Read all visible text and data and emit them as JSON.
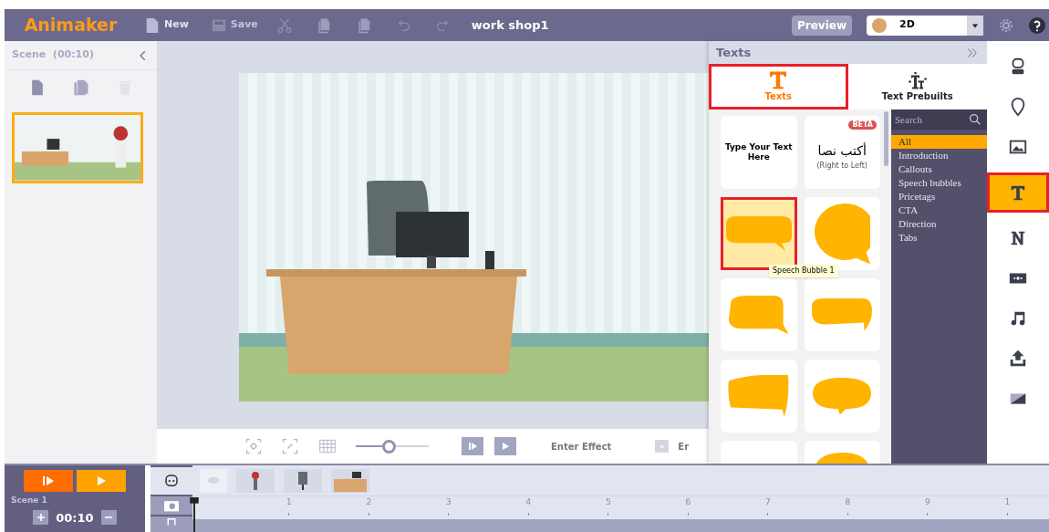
{
  "toolbar": {
    "logo": "Animaker",
    "buttons": [
      {
        "label": "New",
        "disabled": false
      },
      {
        "label": "Save",
        "disabled": true
      }
    ],
    "project_title": "work shop1",
    "preview": "Preview",
    "mode": "2D"
  },
  "scene_panel": {
    "title": "Scene  (00:10)",
    "scenes": [
      {
        "selected": true
      }
    ]
  },
  "canvas_controls": {
    "zoom": {
      "level": 0.45
    },
    "effect_label": "Enter Effect",
    "effect_label_2": "Er"
  },
  "texts_panel": {
    "title": "Texts",
    "tabs": [
      {
        "label": "Texts",
        "selected": true
      },
      {
        "label": "Text Prebuilts",
        "selected": false
      }
    ],
    "items": [
      {
        "kind": "text",
        "title": "Type Your Text Here"
      },
      {
        "kind": "rtl",
        "badge": "BETA",
        "title": "أكتب نصا",
        "subtitle": "(Right to Left)"
      },
      {
        "kind": "bubble",
        "selected": true
      },
      {
        "kind": "bubble",
        "selected": false
      },
      {
        "kind": "bubble",
        "selected": false
      },
      {
        "kind": "bubble",
        "selected": false
      },
      {
        "kind": "bubble",
        "selected": false
      },
      {
        "kind": "bubble",
        "selected": false
      },
      {
        "kind": "bubble",
        "selected": false
      },
      {
        "kind": "bubble",
        "selected": false
      }
    ],
    "tooltip": "Speech Bubble 1",
    "search": {
      "placeholder": "Search"
    },
    "categories": [
      {
        "label": "All",
        "selected": true
      },
      {
        "label": "Introduction",
        "selected": false
      },
      {
        "label": "Callouts",
        "selected": false
      },
      {
        "label": "Speech bubbles",
        "selected": false
      },
      {
        "label": "Pricetags",
        "selected": false
      },
      {
        "label": "CTA",
        "selected": false
      },
      {
        "label": "Direction",
        "selected": false
      },
      {
        "label": "Tabs",
        "selected": false
      }
    ]
  },
  "right_sidebar": [
    {
      "selected": false
    },
    {
      "selected": false
    },
    {
      "selected": false
    },
    {
      "selected": true
    },
    {
      "selected": false
    },
    {
      "selected": false
    },
    {
      "selected": false
    },
    {
      "selected": false
    },
    {
      "selected": false
    }
  ],
  "timeline": {
    "scene_label": "Scene 1",
    "duration": "00:10",
    "ticks": [
      "1",
      "2",
      "3",
      "4",
      "5",
      "6",
      "7",
      "8",
      "9",
      "1"
    ]
  }
}
